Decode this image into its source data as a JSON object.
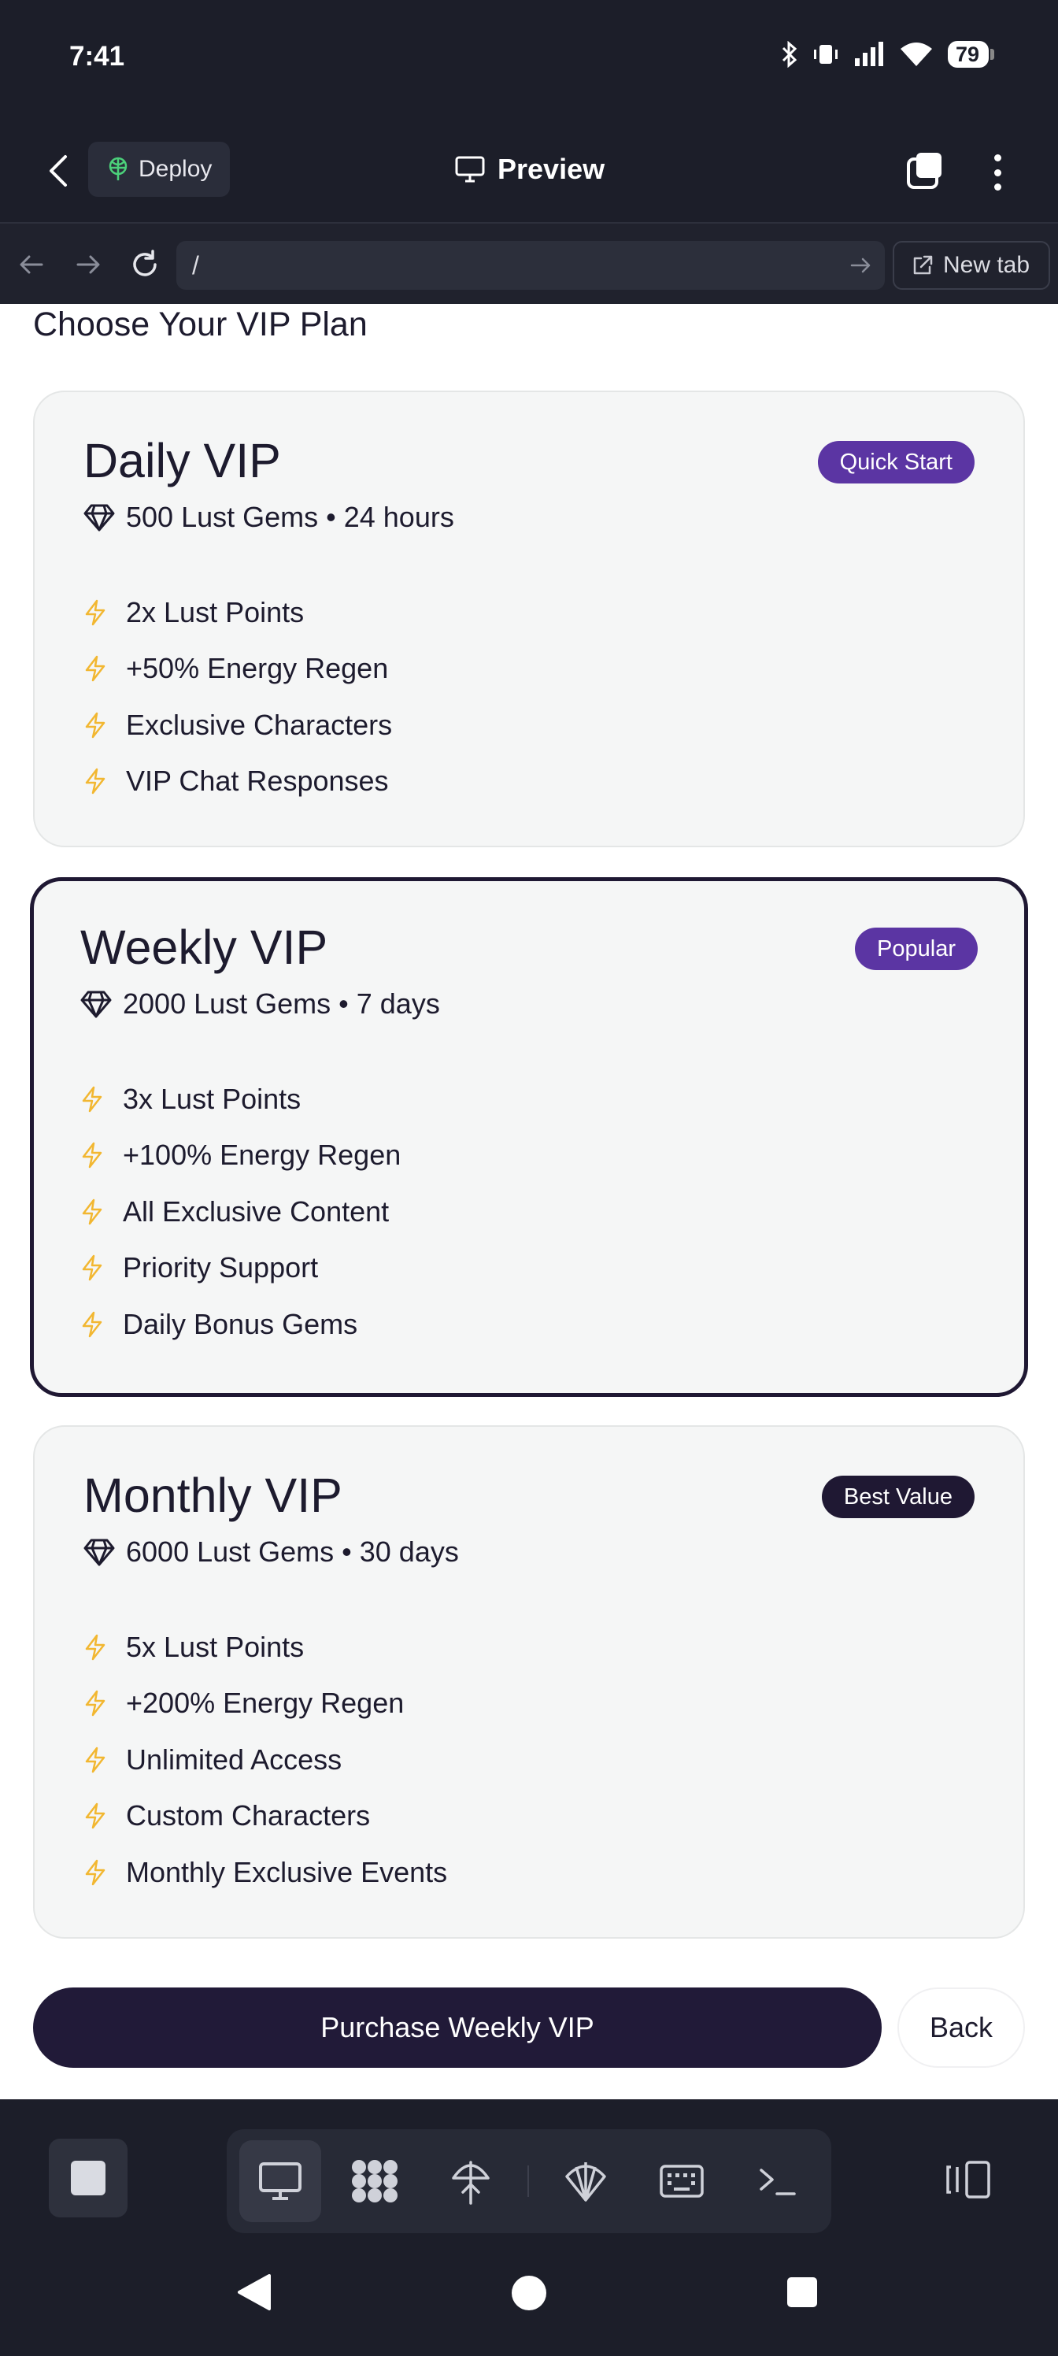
{
  "status_bar": {
    "time": "7:41",
    "battery": "79",
    "icons": [
      "bluetooth-icon",
      "vibrate-icon",
      "signal-icon",
      "wifi-icon",
      "battery-icon"
    ]
  },
  "app_bar": {
    "deploy_label": "Deploy",
    "title": "Preview"
  },
  "browser": {
    "url": "/",
    "new_tab_label": "New tab"
  },
  "page": {
    "title": "Choose Your VIP Plan",
    "plans": [
      {
        "name": "Daily VIP",
        "badge": "Quick Start",
        "badge_color": "#5b35a3",
        "gems": "500 Lust Gems • 24 hours",
        "features": [
          "2x Lust Points",
          "+50% Energy Regen",
          "Exclusive Characters",
          "VIP Chat Responses"
        ]
      },
      {
        "name": "Weekly VIP",
        "badge": "Popular",
        "badge_color": "#5b35a3",
        "selected": true,
        "gems": "2000 Lust Gems • 7 days",
        "features": [
          "3x Lust Points",
          "+100% Energy Regen",
          "All Exclusive Content",
          "Priority Support",
          "Daily Bonus Gems"
        ]
      },
      {
        "name": "Monthly VIP",
        "badge": "Best Value",
        "badge_color": "#1f1833",
        "gems": "6000 Lust Gems • 30 days",
        "features": [
          "5x Lust Points",
          "+200% Energy Regen",
          "Unlimited Access",
          "Custom Characters",
          "Monthly Exclusive Events"
        ]
      }
    ],
    "purchase_label": "Purchase Weekly VIP",
    "back_label": "Back"
  },
  "toolbar": {
    "tools": [
      "desktop-icon",
      "apps-icon",
      "deploy-icon",
      "shell-icon",
      "keyboard-icon",
      "terminal-icon"
    ],
    "active_tool": "desktop-icon"
  },
  "colors": {
    "accent_purple": "#5b35a3",
    "dark": "#1f1833",
    "feature_icon": "#f2b731"
  }
}
